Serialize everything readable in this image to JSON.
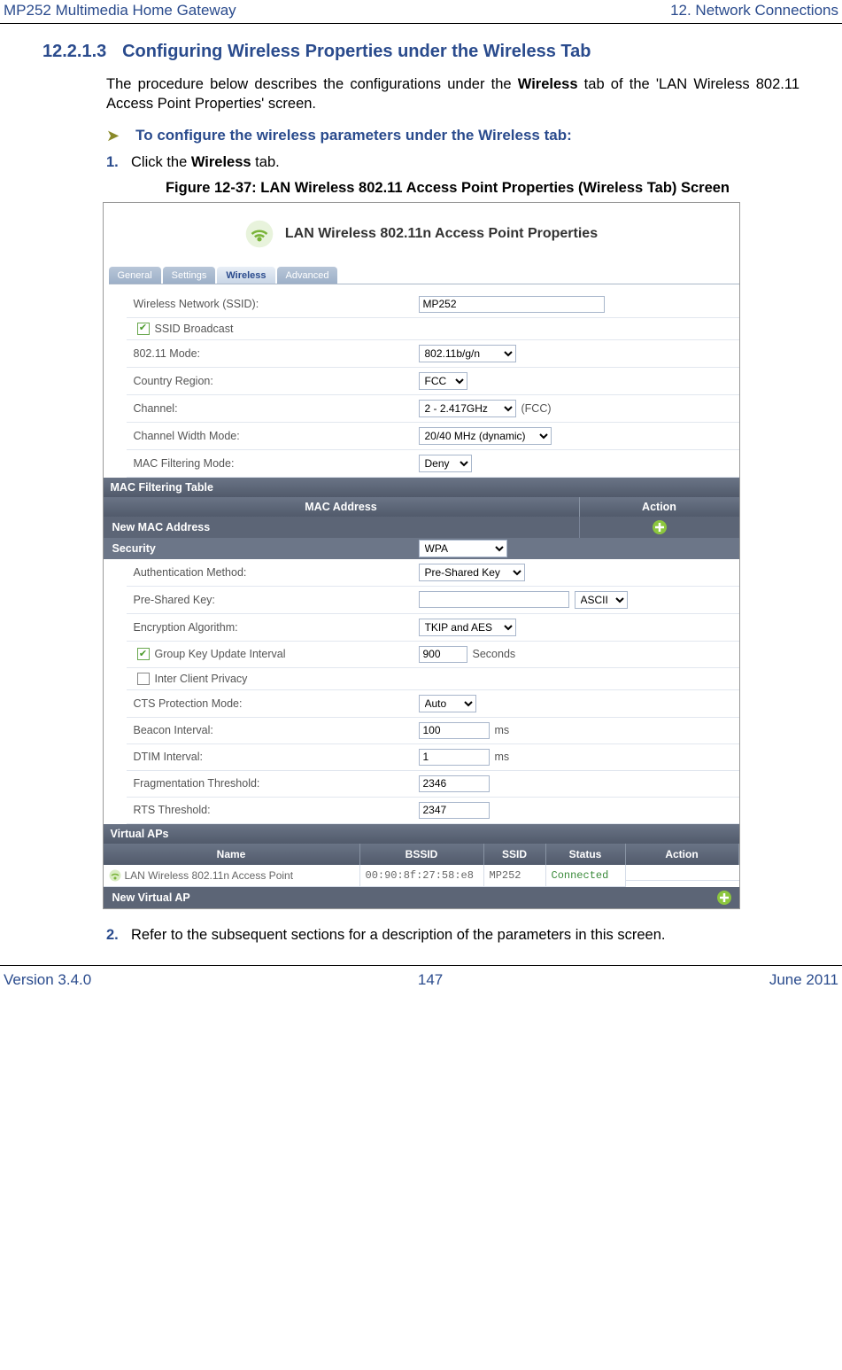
{
  "doc": {
    "header_left": "MP252 Multimedia Home Gateway",
    "header_right": "12. Network Connections",
    "footer_left": "Version 3.4.0",
    "footer_center": "147",
    "footer_right": "June 2011"
  },
  "section": {
    "number": "12.2.1.3",
    "title": "Configuring Wireless Properties under the Wireless Tab",
    "intro_before_bold": "The procedure below describes the configurations under the ",
    "intro_bold": "Wireless",
    "intro_after_bold": " tab of the 'LAN Wireless 802.11 Access Point Properties' screen.",
    "proc_title": "To configure the wireless parameters under the Wireless tab:",
    "step1_num": "1.",
    "step1_a": "Click the ",
    "step1_b": "Wireless",
    "step1_c": " tab.",
    "figure_caption": "Figure 12-37: LAN Wireless 802.11 Access Point Properties (Wireless Tab) Screen",
    "step2_num": "2.",
    "step2_text": "Refer to the subsequent sections for a description of the parameters in this screen."
  },
  "ui": {
    "title": "LAN Wireless 802.11n Access Point Properties",
    "tabs": [
      "General",
      "Settings",
      "Wireless",
      "Advanced"
    ],
    "ssid_label": "Wireless Network (SSID):",
    "ssid_value": "MP252",
    "ssid_broadcast": "SSID Broadcast",
    "mode_label": "802.11 Mode:",
    "mode_value": "802.11b/g/n",
    "region_label": "Country Region:",
    "region_value": "FCC",
    "channel_label": "Channel:",
    "channel_value": "2 - 2.417GHz",
    "channel_suffix": "(FCC)",
    "chwidth_label": "Channel Width Mode:",
    "chwidth_value": "20/40 MHz (dynamic)",
    "macfilter_label": "MAC Filtering Mode:",
    "macfilter_value": "Deny",
    "mac_table_title": "MAC Filtering Table",
    "mac_table_col1": "MAC Address",
    "mac_table_col2": "Action",
    "new_mac": "New MAC Address",
    "security_label": "Security",
    "security_value": "WPA",
    "auth_label": "Authentication Method:",
    "auth_value": "Pre-Shared Key",
    "psk_label": "Pre-Shared Key:",
    "psk_value": "",
    "psk_type": "ASCII",
    "enc_label": "Encryption Algorithm:",
    "enc_value": "TKIP and AES",
    "gkui_label": "Group Key Update Interval",
    "gkui_value": "900",
    "gkui_unit": "Seconds",
    "icp_label": "Inter Client Privacy",
    "cts_label": "CTS Protection Mode:",
    "cts_value": "Auto",
    "beacon_label": "Beacon Interval:",
    "beacon_value": "100",
    "beacon_unit": "ms",
    "dtim_label": "DTIM Interval:",
    "dtim_value": "1",
    "dtim_unit": "ms",
    "frag_label": "Fragmentation Threshold:",
    "frag_value": "2346",
    "rts_label": "RTS Threshold:",
    "rts_value": "2347",
    "vap_title": "Virtual APs",
    "vap_cols": {
      "name": "Name",
      "bssid": "BSSID",
      "ssid": "SSID",
      "status": "Status",
      "action": "Action"
    },
    "vap_row": {
      "name": "LAN Wireless 802.11n Access Point",
      "bssid": "00:90:8f:27:58:e8",
      "ssid": "MP252",
      "status": "Connected"
    },
    "new_vap": "New Virtual AP"
  }
}
